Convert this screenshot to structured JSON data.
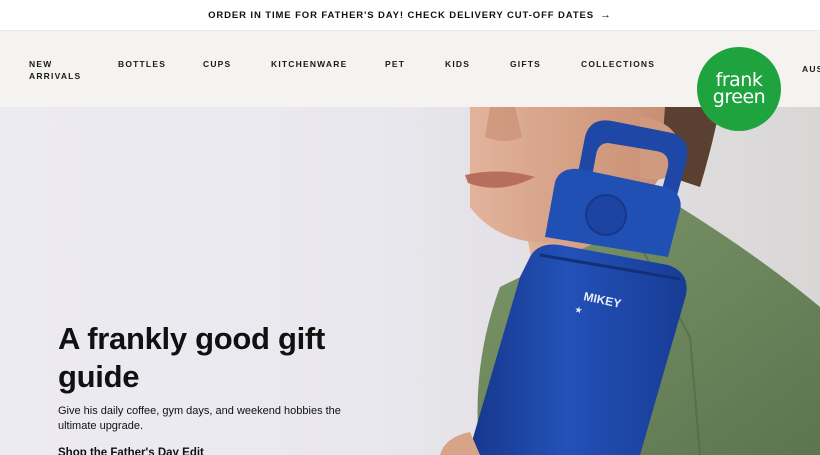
{
  "announcement": {
    "text": "ORDER IN TIME FOR FATHER'S DAY! CHECK DELIVERY CUT-OFF DATES",
    "arrow": "→"
  },
  "nav": {
    "items": [
      {
        "label": "NEW ARRIVALS"
      },
      {
        "label": "BOTTLES"
      },
      {
        "label": "CUPS"
      },
      {
        "label": "KITCHENWARE"
      },
      {
        "label": "PET"
      },
      {
        "label": "KIDS"
      },
      {
        "label": "GIFTS"
      },
      {
        "label": "COLLECTIONS"
      }
    ],
    "region": "AUS"
  },
  "logo": {
    "line1": "frank",
    "line2": "green",
    "color": "#1fa33f"
  },
  "hero": {
    "title": "A frankly good gift guide",
    "subtitle": "Give his daily coffee, gym days, and weekend hobbies the ultimate upgrade.",
    "cta": "Shop the Father's Day Edit",
    "bottle_text": "MIKEY",
    "bottle_star": "★",
    "colors": {
      "bottle": "#1e46a8",
      "shirt": "#6f8a5f",
      "skin": "#d9a58a"
    }
  }
}
